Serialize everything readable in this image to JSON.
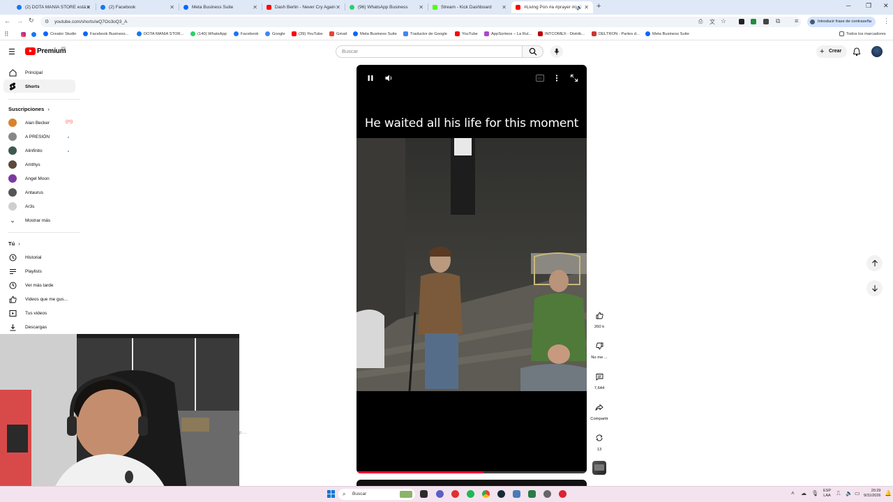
{
  "browser": {
    "tabs": [
      {
        "title": "(2) DOTA MANIA STORE está e",
        "fav": "#1877f2"
      },
      {
        "title": "(2) Facebook",
        "fav": "#1877f2"
      },
      {
        "title": "Meta Business Suite",
        "fav": "#0866ff"
      },
      {
        "title": "Dash Berlin - Never Cry Again",
        "fav": "#ff0000"
      },
      {
        "title": "(96) WhatsApp Business",
        "fav": "#25d366"
      },
      {
        "title": "Stream - Kick Dashboard",
        "fav": "#53fc18"
      },
      {
        "title": "#Living Pon #a #prayer #o",
        "fav": "#ff0000"
      }
    ],
    "url": "youtube.com/shorts/wQ7Oo3oQ3_A",
    "password_chip": "Introducir frase de contraseña",
    "bookmarks": [
      "Creator Studio",
      "Facebook Business...",
      "DOTA MANIA STOR...",
      "(140) WhatsApp",
      "Facebook",
      "Google",
      "(39) YouTube",
      "Gmail",
      "Meta Business Suite",
      "Traductor de Google",
      "YouTube",
      "AppSorteos – La Rul...",
      "INTCOMEX - Distrib...",
      "DELTRON - Partes d...",
      "Meta Business Suite"
    ],
    "all_bookmarks": "Todos los marcadores"
  },
  "yt": {
    "logo_text": "Premium",
    "logo_sup": "PE",
    "search_placeholder": "Buscar",
    "create_label": "Crear"
  },
  "sidebar": {
    "main": [
      {
        "label": "Principal",
        "icon": "home-icon"
      },
      {
        "label": "Shorts",
        "icon": "shorts-icon"
      }
    ],
    "subs_header": "Suscripciones",
    "subs": [
      {
        "label": "Alan Becker",
        "color": "#d9822b",
        "badge": "live"
      },
      {
        "label": "A PRESIÓN",
        "color": "#888888",
        "badge": "dot"
      },
      {
        "label": "Alinfinito",
        "color": "#3c5a50",
        "badge": "dot"
      },
      {
        "label": "Amthys",
        "color": "#5a4a3a",
        "badge": ""
      },
      {
        "label": "Angel Moon",
        "color": "#7a3aa0",
        "badge": ""
      },
      {
        "label": "Antaurus",
        "color": "#555555",
        "badge": ""
      },
      {
        "label": "Ar3s",
        "color": "#cfcfcf",
        "badge": ""
      }
    ],
    "show_more": "Mostrar más",
    "you_header": "Tú",
    "you": [
      {
        "label": "Historial",
        "icon": "history-icon"
      },
      {
        "label": "Playlists",
        "icon": "playlists-icon"
      },
      {
        "label": "Ver más tarde",
        "icon": "watch-later-icon"
      },
      {
        "label": "Videos que me gus...",
        "icon": "liked-videos-icon"
      },
      {
        "label": "Tus videos",
        "icon": "your-videos-icon"
      },
      {
        "label": "Descargas",
        "icon": "downloads-icon"
      }
    ]
  },
  "video": {
    "caption": "He waited all his life for this moment",
    "progress": 0.55
  },
  "actions": {
    "likes": "260 k",
    "dislike": "No me ...",
    "comments": "7,644",
    "share": "Compartir",
    "remix": "13"
  },
  "overflow_text": "p ...",
  "taskbar": {
    "search": "Buscar",
    "lang1": "ESP",
    "lang2": "LAA",
    "time": "20:29",
    "date": "9/31/2026"
  }
}
